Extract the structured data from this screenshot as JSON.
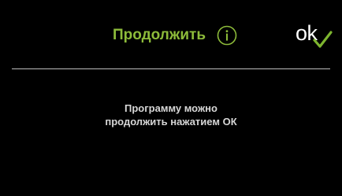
{
  "header": {
    "title": "Продолжить",
    "info_icon": "info-icon",
    "ok_label": "ok",
    "check_icon": "check-icon"
  },
  "message": {
    "line1": "Программу можно",
    "line2": "продолжить нажатием ОК"
  },
  "colors": {
    "background": "#000000",
    "title": "#8dbb3a",
    "check": "#7db52f",
    "text": "#d7d7d7",
    "divider": "#bdbdbd",
    "ok_text": "#ffffff"
  }
}
